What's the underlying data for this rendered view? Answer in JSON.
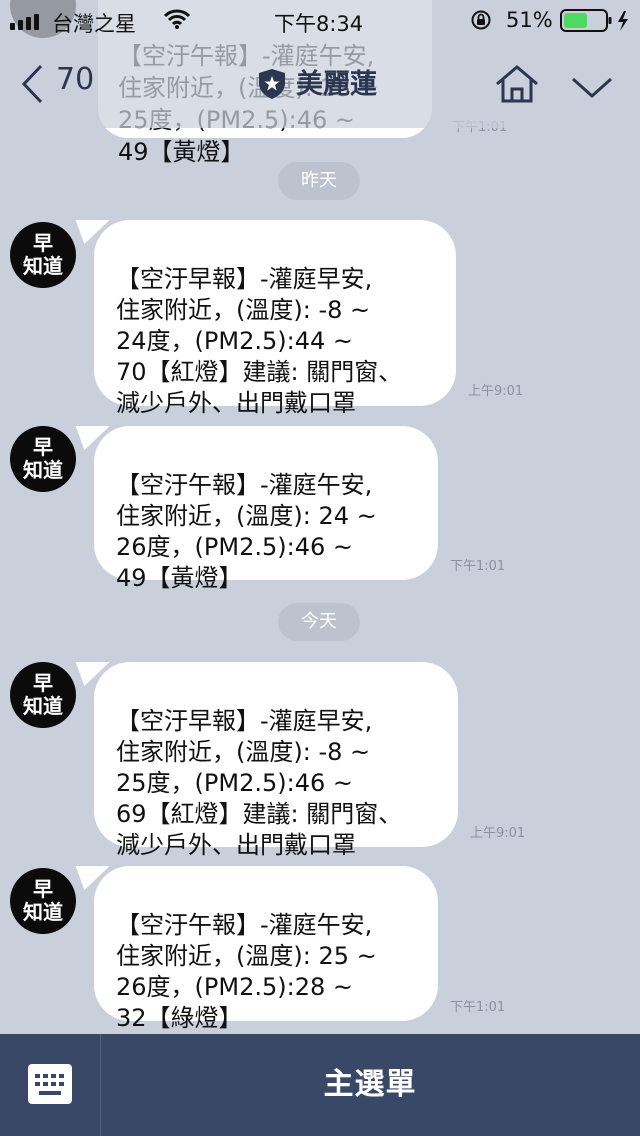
{
  "status_bar": {
    "carrier": "台灣之星",
    "time": "下午8:34",
    "battery": "51%"
  },
  "nav": {
    "back_count": "70",
    "title": "美麗蓮"
  },
  "top_partial": {
    "text": "【空汙午報】-灌庭午安,\n住家附近，(溫度): 23 ~\n25度，(PM2.5):46 ~\n49【黃燈】",
    "time": "下午1:01"
  },
  "date_separators": [
    "昨天",
    "今天"
  ],
  "avatar_label": "早\n知道",
  "messages": [
    {
      "text": "【空汙早報】-灌庭早安,\n住家附近，(溫度): -8 ~\n24度，(PM2.5):44 ~\n70【紅燈】建議: 關門窗、\n減少戶外、出門戴口罩",
      "time": "上午9:01"
    },
    {
      "text": "【空汙午報】-灌庭午安,\n住家附近，(溫度): 24 ~\n26度，(PM2.5):46 ~\n49【黃燈】",
      "time": "下午1:01"
    },
    {
      "text": "【空汙早報】-灌庭早安,\n住家附近，(溫度): -8 ~\n25度，(PM2.5):46 ~\n69【紅燈】建議: 關門窗、\n減少戶外、出門戴口罩",
      "time": "上午9:01"
    },
    {
      "text": "【空汙午報】-灌庭午安,\n住家附近，(溫度): 25 ~\n26度，(PM2.5):28 ~\n32【綠燈】",
      "time": "下午1:01"
    }
  ],
  "bottom": {
    "menu_label": "主選單"
  },
  "colors": {
    "chat_bg": "#c9d0dc",
    "bottom_bar": "#3a4868",
    "accent": "#2c3650",
    "battery": "#4cd964"
  }
}
